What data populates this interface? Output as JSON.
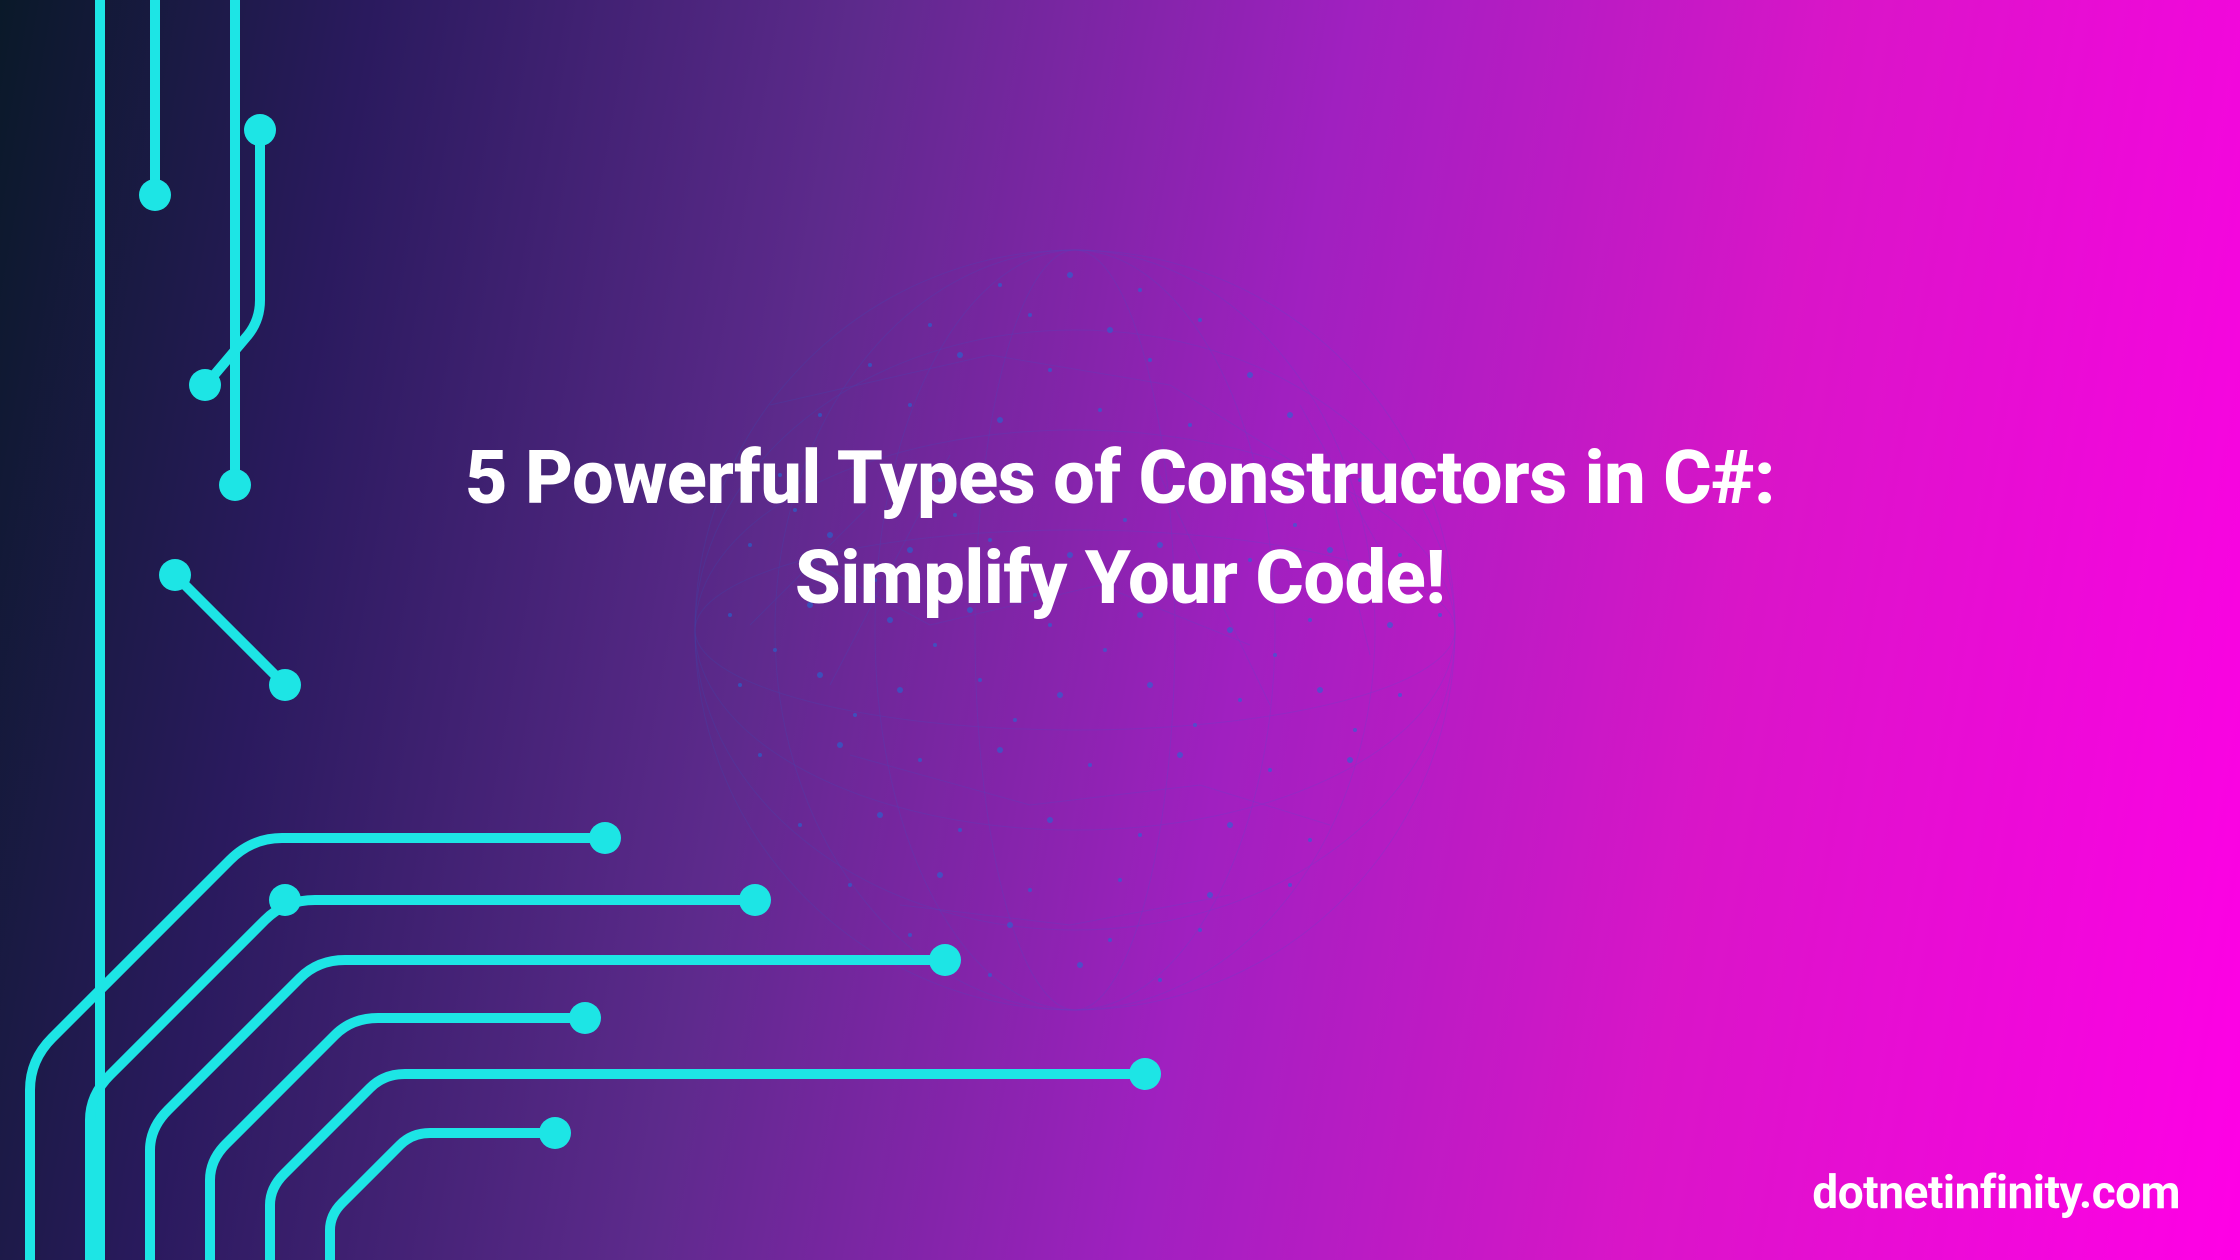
{
  "title": {
    "line1": "5 Powerful Types of Constructors in C#:",
    "line2": "Simplify Your Code!"
  },
  "watermark": "dotnetinfinity.com",
  "colors": {
    "circuit": "#1de5e5",
    "globe": "#1a6fd9",
    "text": "#ffffff",
    "gradient_start": "#0a1929",
    "gradient_end": "#ff00e6"
  }
}
